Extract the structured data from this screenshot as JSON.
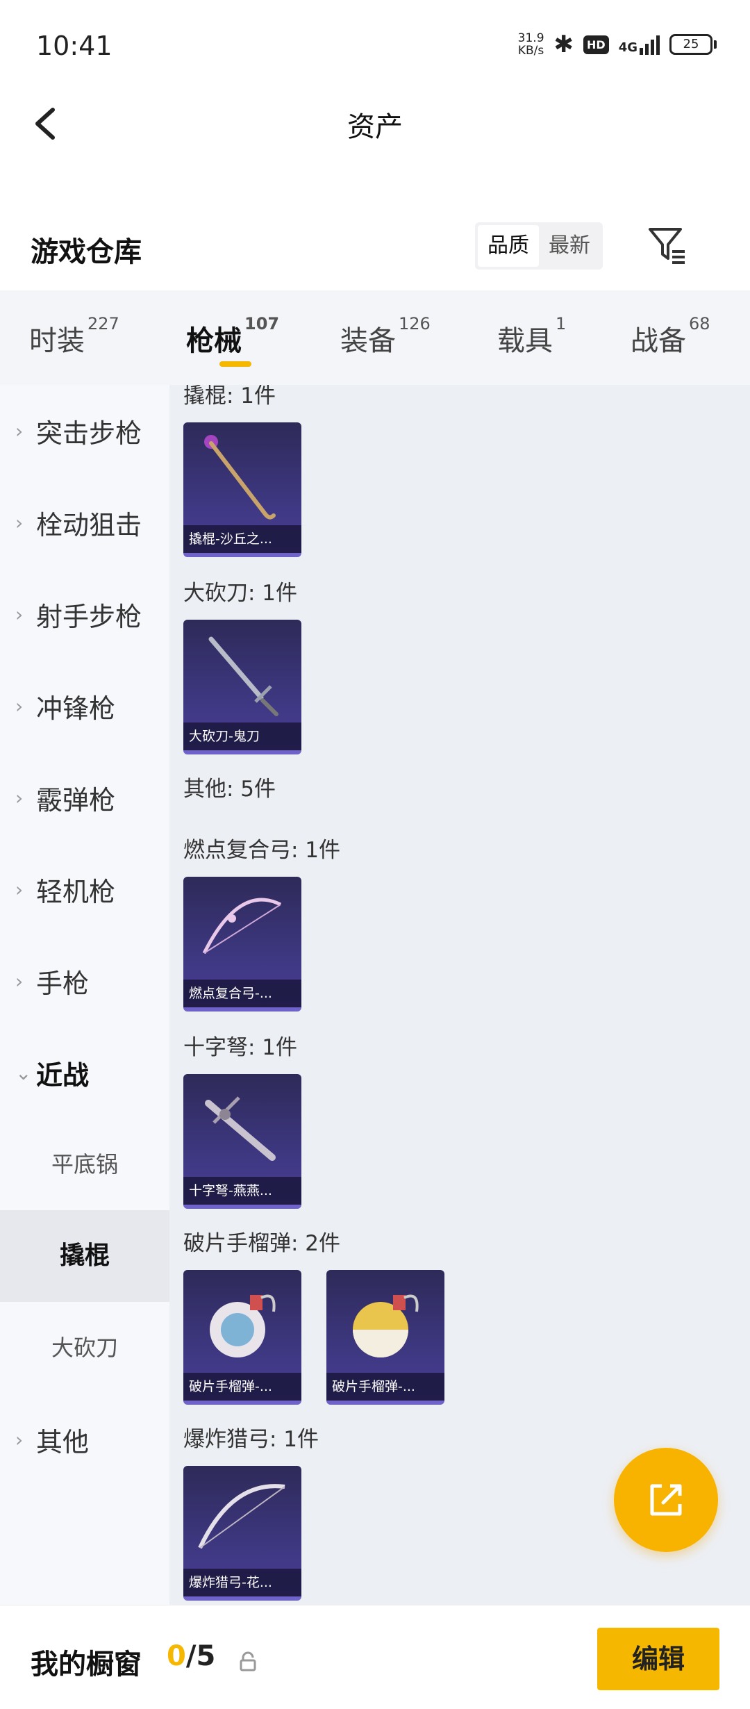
{
  "status_bar": {
    "time": "10:41",
    "net_speed_value": "31.9",
    "net_speed_unit": "KB/s",
    "hd_badge": "HD",
    "network": "4G",
    "battery": "25"
  },
  "header": {
    "title": "资产"
  },
  "section": {
    "title": "游戏仓库",
    "sort_options": [
      "品质",
      "最新"
    ],
    "active_sort": "品质"
  },
  "tabs": [
    {
      "label": "时装",
      "count": "227"
    },
    {
      "label": "枪械",
      "count": "107",
      "active": true
    },
    {
      "label": "装备",
      "count": "126"
    },
    {
      "label": "载具",
      "count": "1"
    },
    {
      "label": "战备",
      "count": "68"
    }
  ],
  "sidebar": {
    "categories": [
      "突击步枪",
      "栓动狙击",
      "射手步枪",
      "冲锋枪",
      "霰弹枪",
      "轻机枪",
      "手枪"
    ],
    "open_category": "近战",
    "subitems": [
      "平底锅",
      "撬棍",
      "大砍刀"
    ],
    "active_subitem": "撬棍",
    "last_category": "其他"
  },
  "content": {
    "groups": [
      {
        "title": "撬棍: 1件",
        "items": [
          "撬棍-沙丘之..."
        ]
      },
      {
        "title": "大砍刀: 1件",
        "items": [
          "大砍刀-鬼刀"
        ]
      },
      {
        "title": "其他: 5件",
        "items": []
      },
      {
        "title": "燃点复合弓: 1件",
        "items": [
          "燃点复合弓-..."
        ]
      },
      {
        "title": "十字弩: 1件",
        "items": [
          "十字弩-燕燕..."
        ]
      },
      {
        "title": "破片手榴弹: 2件",
        "items": [
          "破片手榴弹-...",
          "破片手榴弹-..."
        ]
      },
      {
        "title": "爆炸猎弓: 1件",
        "items": [
          "爆炸猎弓-花..."
        ]
      }
    ]
  },
  "bottom_bar": {
    "title": "我的橱窗",
    "current": "0",
    "total": "/5",
    "edit_label": "编辑"
  },
  "colors": {
    "accent": "#f5b700",
    "card": "#3d3780"
  }
}
